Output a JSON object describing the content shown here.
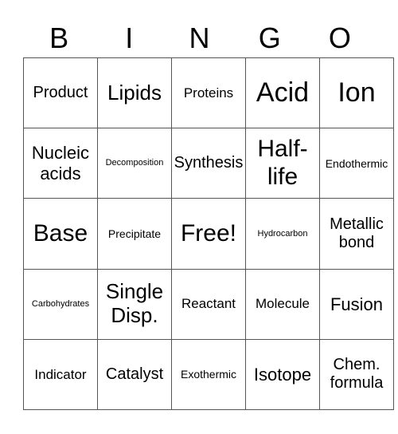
{
  "header": [
    "B",
    "I",
    "N",
    "G",
    "O"
  ],
  "rows": [
    [
      "Product",
      "Lipids",
      "Proteins",
      "Acid",
      "Ion"
    ],
    [
      "Nucleic acids",
      "Decomposition",
      "Synthesis",
      "Half-life",
      "Endothermic"
    ],
    [
      "Base",
      "Precipitate",
      "Free!",
      "Hydrocarbon",
      "Metallic bond"
    ],
    [
      "Carbohydrates",
      "Single Disp.",
      "Reactant",
      "Molecule",
      "Fusion"
    ],
    [
      "Indicator",
      "Catalyst",
      "Exothermic",
      "Isotope",
      "Chem. formula"
    ]
  ]
}
